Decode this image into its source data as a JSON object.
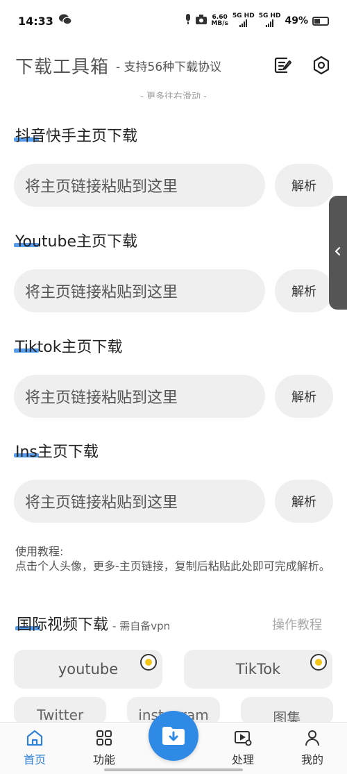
{
  "status_bar": {
    "time": "14:33",
    "net_speed_value": "6.60",
    "net_speed_unit": "MB/s",
    "sim1": "5G HD",
    "sim2": "5G HD",
    "battery": "49%"
  },
  "header": {
    "title": "下载工具箱",
    "subtitle": "- 支持56种下载协议",
    "scroll_hint": "- 更多往右滑动 -"
  },
  "sections": [
    {
      "title": "抖音快手主页下载",
      "placeholder": "将主页链接粘贴到这里",
      "button": "解析"
    },
    {
      "title": "Youtube主页下载",
      "placeholder": "将主页链接粘贴到这里",
      "button": "解析"
    },
    {
      "title": "Tiktok主页下载",
      "placeholder": "将主页链接粘贴到这里",
      "button": "解析"
    },
    {
      "title": "Ins主页下载",
      "placeholder": "将主页链接粘贴到这里",
      "button": "解析"
    }
  ],
  "tutorial": {
    "heading": "使用教程:",
    "body": "点击个人头像，更多-主页链接，复制后粘贴此处即可完成解析。"
  },
  "intl": {
    "title": "国际视频下载",
    "note": "- 需自备vpn",
    "tutorial_link": "操作教程",
    "buttons": [
      "youtube",
      "TikTok"
    ],
    "partial": [
      "Twitter",
      "instagram",
      "图集"
    ]
  },
  "nav": {
    "items": [
      "首页",
      "功能",
      "处理",
      "我的"
    ],
    "active": "首页"
  },
  "colors": {
    "accent": "#2f8ae6",
    "pill_bg": "#efefef",
    "title_bar": "#3a8ae8"
  }
}
